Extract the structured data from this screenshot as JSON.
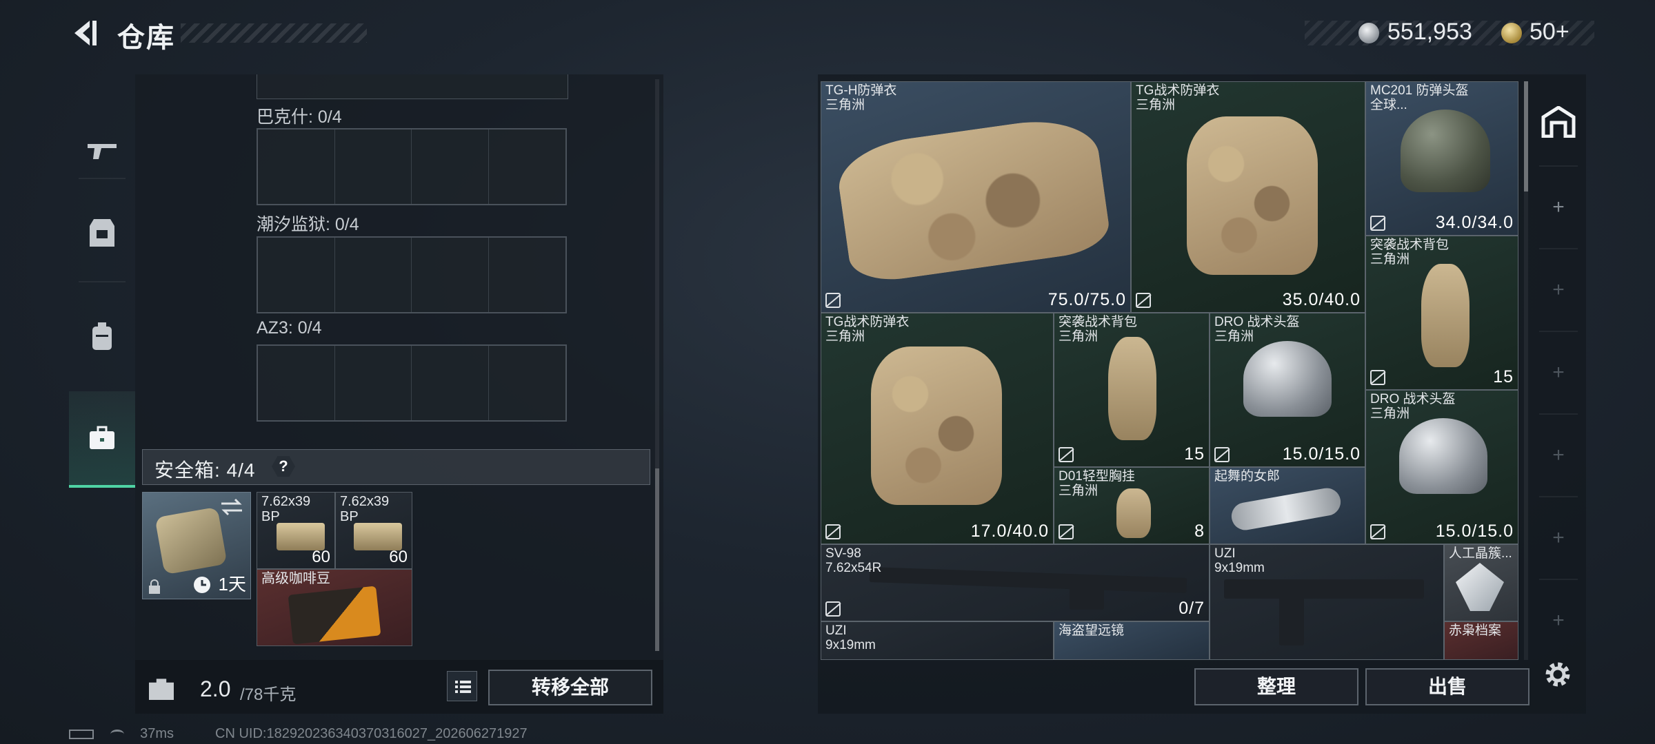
{
  "header": {
    "title": "仓库",
    "money": "551,953",
    "bonds": "50+"
  },
  "left": {
    "slots": [
      {
        "label": "巴克什: 0/4"
      },
      {
        "label": "潮汐监狱: 0/4"
      },
      {
        "label": "AZ3: 0/4"
      }
    ],
    "safebox_label": "安全箱: 4/4",
    "help": "?",
    "safebox_time": "1天",
    "items": [
      {
        "name": "7.62x39\nBP",
        "count": "60"
      },
      {
        "name": "7.62x39\nBP",
        "count": "60"
      },
      {
        "name": "高级咖啡豆",
        "count": ""
      }
    ],
    "weight": "2.0",
    "weight_max": "/78千克",
    "transfer_label": "转移全部"
  },
  "inventory": {
    "items": [
      {
        "name": "TG-H防弹衣\n三角洲",
        "value": "75.0/75.0"
      },
      {
        "name": "TG战术防弹衣\n三角洲",
        "value": "35.0/40.0"
      },
      {
        "name": "MC201 防弹头盔\n全球...",
        "value": "34.0/34.0"
      },
      {
        "name": "突袭战术背包\n三角洲",
        "value": "15"
      },
      {
        "name": "TG战术防弹衣\n三角洲",
        "value": "17.0/40.0"
      },
      {
        "name": "突袭战术背包\n三角洲",
        "value": "15"
      },
      {
        "name": "DRO 战术头盔\n三角洲",
        "value": "15.0/15.0"
      },
      {
        "name": "DRO 战术头盔\n三角洲",
        "value": "15.0/15.0"
      },
      {
        "name": "D01轻型胸挂\n三角洲",
        "value": "8"
      },
      {
        "name": "起舞的女郎",
        "value": ""
      },
      {
        "name": "SV-98\n7.62x54R",
        "value": "0/7"
      },
      {
        "name": "UZI\n9x19mm",
        "value": ""
      },
      {
        "name": "人工晶簇...",
        "value": ""
      },
      {
        "name": "UZI\n9x19mm",
        "value": ""
      },
      {
        "name": "海盗望远镜",
        "value": ""
      },
      {
        "name": "赤枭档案",
        "value": ""
      }
    ],
    "sort_label": "整理",
    "sell_label": "出售"
  },
  "footer": {
    "ping": "37ms",
    "uid": "CN UID:18292023634037031602​7_202606271927"
  },
  "colors": {
    "accent": "#4fd3a4",
    "panel": "#1b2128",
    "text": "#e4e7ea"
  },
  "icons": {
    "back": "back-arrow-icon",
    "gun": "gun-icon",
    "armor": "armor-icon",
    "backpack": "backpack-icon",
    "case": "briefcase-icon",
    "settings": "gear-icon"
  }
}
